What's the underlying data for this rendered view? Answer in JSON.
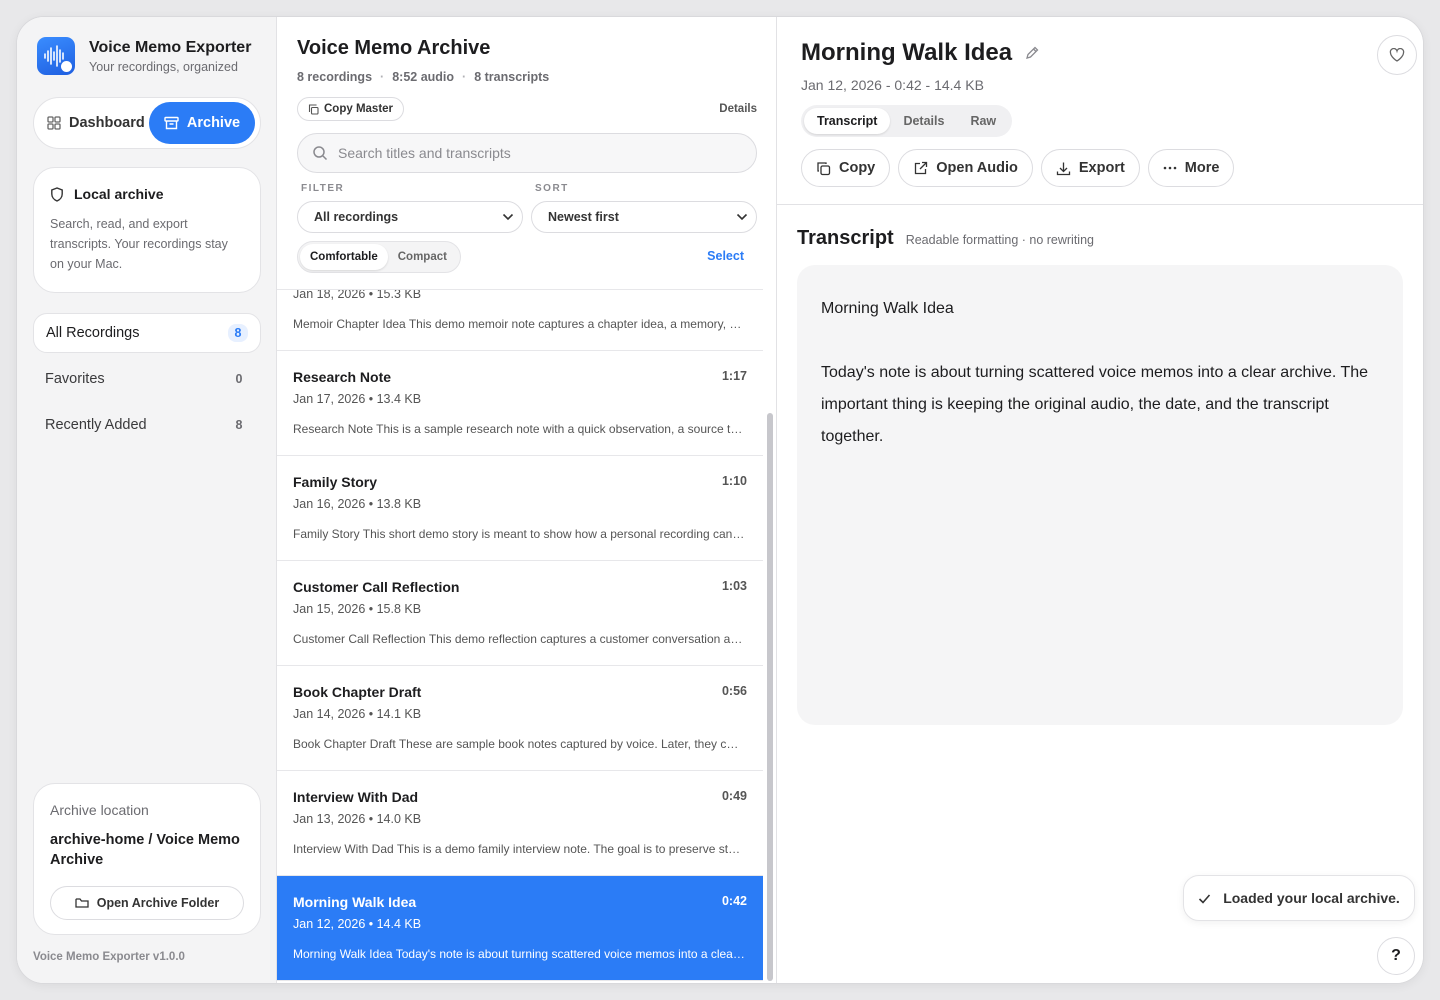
{
  "app": {
    "title": "Voice Memo Exporter",
    "subtitle": "Your recordings, organized",
    "version": "Voice Memo Exporter v1.0.0",
    "accent": "#2b7cf6"
  },
  "sidebar": {
    "tabs": [
      {
        "label": "Dashboard"
      },
      {
        "label": "Archive"
      }
    ],
    "local_card": {
      "title": "Local archive",
      "body": "Search, read, and export transcripts. Your recordings stay on your Mac."
    },
    "nav": [
      {
        "label": "All Recordings",
        "count": "8"
      },
      {
        "label": "Favorites",
        "count": "0"
      },
      {
        "label": "Recently Added",
        "count": "8"
      }
    ],
    "location": {
      "label": "Archive location",
      "path": "archive-home / Voice Memo Archive",
      "button": "Open Archive Folder"
    }
  },
  "list": {
    "title": "Voice Memo Archive",
    "stats": [
      "8 recordings",
      "8:52 audio",
      "8 transcripts"
    ],
    "copy_master": "Copy Master",
    "details": "Details",
    "search_placeholder": "Search titles and transcripts",
    "filter_label": "FILTER",
    "sort_label": "SORT",
    "filter_value": "All recordings",
    "sort_value": "Newest first",
    "density": [
      "Comfortable",
      "Compact"
    ],
    "select": "Select",
    "items": [
      {
        "title": "",
        "duration": "",
        "meta": "Jan 18, 2026 • 15.3 KB",
        "preview": "Memoir Chapter Idea This demo memoir note captures a chapter idea, a memory, and a few details to expand later."
      },
      {
        "title": "Research Note",
        "duration": "1:17",
        "meta": "Jan 17, 2026 • 13.4 KB",
        "preview": "Research Note This is a sample research note with a quick observation, a source to check, and next steps."
      },
      {
        "title": "Family Story",
        "duration": "1:10",
        "meta": "Jan 16, 2026 • 13.8 KB",
        "preview": "Family Story This short demo story is meant to show how a personal recording can be saved and searched."
      },
      {
        "title": "Customer Call Reflection",
        "duration": "1:03",
        "meta": "Jan 15, 2026 • 15.8 KB",
        "preview": "Customer Call Reflection This demo reflection captures a customer conversation and the follow-ups needed."
      },
      {
        "title": "Book Chapter Draft",
        "duration": "0:56",
        "meta": "Jan 14, 2026 • 14.1 KB",
        "preview": "Book Chapter Draft These are sample book notes captured by voice. Later, they can be cleaned up and edited."
      },
      {
        "title": "Interview With Dad",
        "duration": "0:49",
        "meta": "Jan 13, 2026 • 14.0 KB",
        "preview": "Interview With Dad This is a demo family interview note. The goal is to preserve stories in his own words."
      },
      {
        "title": "Morning Walk Idea",
        "duration": "0:42",
        "meta": "Jan 12, 2026 • 14.4 KB",
        "preview": "Morning Walk Idea Today's note is about turning scattered voice memos into a clear archive."
      }
    ]
  },
  "detail": {
    "title": "Morning Walk Idea",
    "meta": "Jan 12, 2026 - 0:42 - 14.4 KB",
    "tabs": [
      "Transcript",
      "Details",
      "Raw"
    ],
    "actions": [
      "Copy",
      "Open Audio",
      "Export",
      "More"
    ],
    "transcript_title": "Transcript",
    "transcript_sub": "Readable formatting · no rewriting",
    "transcript": [
      "Morning Walk Idea",
      "Today's note is about turning scattered voice memos into a clear archive. The important thing is keeping the original audio, the date, and the transcript together."
    ]
  },
  "toast": "Loaded your local archive.",
  "help": "?"
}
